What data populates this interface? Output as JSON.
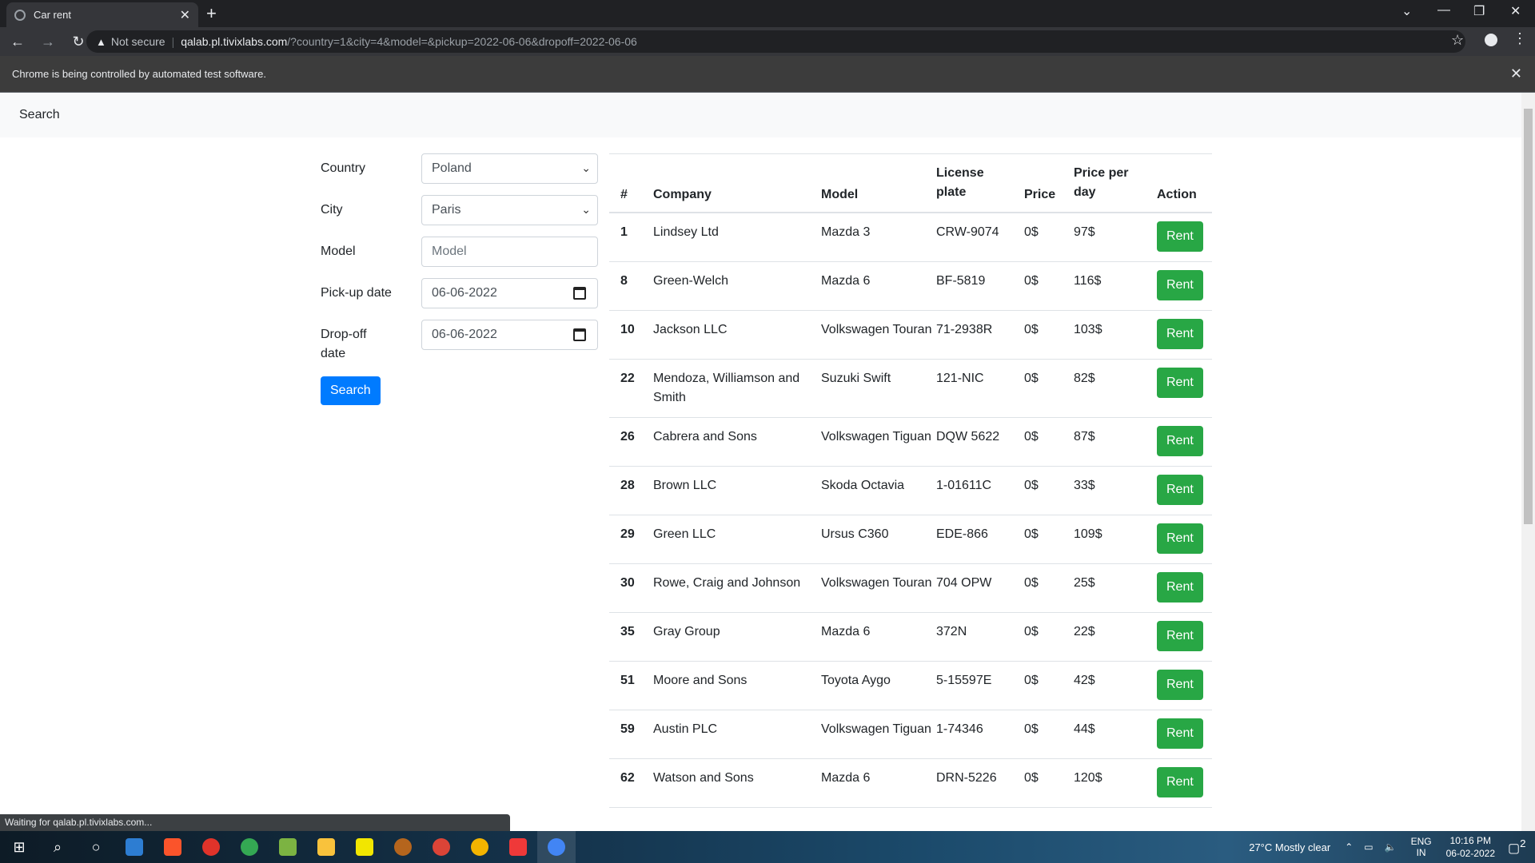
{
  "browser": {
    "tab_title": "Car rent",
    "not_secure": "Not secure",
    "url_host": "qalab.pl.tivixlabs.com",
    "url_path": "/?country=1&city=4&model=&pickup=2022-06-06&dropoff=2022-06-06",
    "infobar_text": "Chrome is being controlled by automated test software.",
    "status_text": "Waiting for qalab.pl.tivixlabs.com..."
  },
  "navbar": {
    "brand": "Search"
  },
  "form": {
    "country_label": "Country",
    "country_value": "Poland",
    "city_label": "City",
    "city_value": "Paris",
    "model_label": "Model",
    "model_placeholder": "Model",
    "pickup_label": "Pick-up date",
    "pickup_value": "06-06-2022",
    "dropoff_label": "Drop-off date",
    "dropoff_value": "06-06-2022",
    "search_label": "Search"
  },
  "table": {
    "headers": [
      "#",
      "Company",
      "Model",
      "License plate",
      "Price",
      "Price per day",
      "Action"
    ],
    "rows": [
      {
        "id": "1",
        "company": "Lindsey Ltd",
        "model": "Mazda 3",
        "plate": "CRW-9074",
        "price": "0$",
        "ppd": "97$",
        "action": "Rent"
      },
      {
        "id": "8",
        "company": "Green-Welch",
        "model": "Mazda 6",
        "plate": "BF-5819",
        "price": "0$",
        "ppd": "116$",
        "action": "Rent"
      },
      {
        "id": "10",
        "company": "Jackson LLC",
        "model": "Volkswagen Touran",
        "plate": "71-2938R",
        "price": "0$",
        "ppd": "103$",
        "action": "Rent"
      },
      {
        "id": "22",
        "company": "Mendoza, Williamson and Smith",
        "model": "Suzuki Swift",
        "plate": "121-NIC",
        "price": "0$",
        "ppd": "82$",
        "action": "Rent"
      },
      {
        "id": "26",
        "company": "Cabrera and Sons",
        "model": "Volkswagen Tiguan",
        "plate": "DQW 5622",
        "price": "0$",
        "ppd": "87$",
        "action": "Rent"
      },
      {
        "id": "28",
        "company": "Brown LLC",
        "model": "Skoda Octavia",
        "plate": "1-01611C",
        "price": "0$",
        "ppd": "33$",
        "action": "Rent"
      },
      {
        "id": "29",
        "company": "Green LLC",
        "model": "Ursus C360",
        "plate": "EDE-866",
        "price": "0$",
        "ppd": "109$",
        "action": "Rent"
      },
      {
        "id": "30",
        "company": "Rowe, Craig and Johnson",
        "model": "Volkswagen Touran",
        "plate": "704 OPW",
        "price": "0$",
        "ppd": "25$",
        "action": "Rent"
      },
      {
        "id": "35",
        "company": "Gray Group",
        "model": "Mazda 6",
        "plate": "372N",
        "price": "0$",
        "ppd": "22$",
        "action": "Rent"
      },
      {
        "id": "51",
        "company": "Moore and Sons",
        "model": "Toyota Aygo",
        "plate": "5-15597E",
        "price": "0$",
        "ppd": "42$",
        "action": "Rent"
      },
      {
        "id": "59",
        "company": "Austin PLC",
        "model": "Volkswagen Tiguan",
        "plate": "1-74346",
        "price": "0$",
        "ppd": "44$",
        "action": "Rent"
      },
      {
        "id": "62",
        "company": "Watson and Sons",
        "model": "Mazda 6",
        "plate": "DRN-5226",
        "price": "0$",
        "ppd": "120$",
        "action": "Rent"
      }
    ]
  },
  "taskbar": {
    "weather": "27°C  Mostly clear",
    "lang_top": "ENG",
    "lang_bottom": "IN",
    "time": "10:16 PM",
    "date": "06-02-2022",
    "notif_count": "2"
  }
}
